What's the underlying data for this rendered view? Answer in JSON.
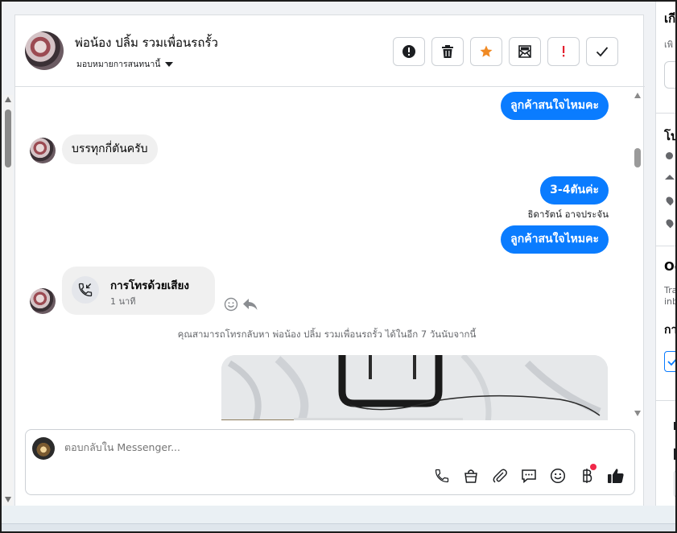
{
  "header": {
    "contact_name": "พ่อน้อง ปลิ้ม รวมเพื่อนรถรั้ว",
    "assign_label": "มอบหมายการสนทนานี้",
    "toolbar_icons": [
      "alert-circle-icon",
      "trash-icon",
      "star-icon",
      "mail-icon",
      "exclamation-icon",
      "check-icon"
    ]
  },
  "conversation": {
    "messages": [
      {
        "direction": "out",
        "text": "ลูกค้าสนใจไหมคะ"
      },
      {
        "direction": "in",
        "text": "บรรทุกกี่ตันครับ"
      },
      {
        "direction": "out",
        "text": "3-4ตันค่ะ"
      },
      {
        "direction": "out",
        "text": "ลูกค้าสนใจไหมคะ"
      }
    ],
    "sender_label": "ธิดารัตน์ อาจประจัน",
    "call": {
      "title": "การโทรด้วยเสียง",
      "duration": "1 นาที"
    },
    "system_note": "คุณสามารถโทรกลับหา พ่อน้อง ปลิ้ม รวมเพื่อนรถรั้ว ได้ในอีก 7 วันนับจากนี้"
  },
  "composer": {
    "placeholder": "ตอบกลับใน Messenger...",
    "icons": [
      "phone-icon",
      "shopping-bag-icon",
      "paperclip-icon",
      "chat-icon",
      "emoji-icon",
      "baht-icon",
      "thumbs-up-icon"
    ],
    "badge_color": "#f02849"
  },
  "right_panel": {
    "truncated_heading_1": "เกี",
    "truncated_text_1": "เพิ",
    "truncated_heading_2": "โป",
    "truncated_heading_3": "Oc",
    "truncated_text_3a": "Tra",
    "truncated_text_3b": "inb",
    "truncated_heading_4": "กา"
  },
  "colors": {
    "accent_blue": "#0a7cff",
    "star_orange": "#f08a24",
    "exclaim_red": "#e4202f"
  }
}
